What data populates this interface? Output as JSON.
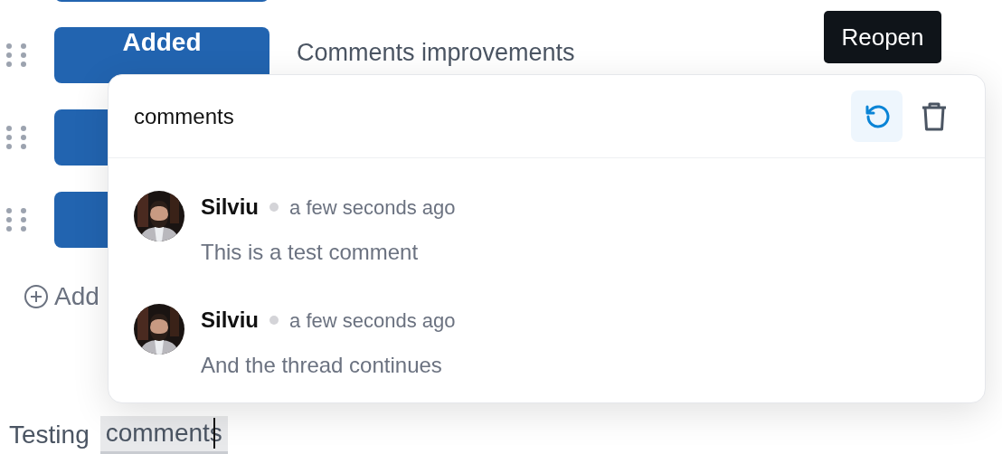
{
  "rows": [
    {
      "kind": "cut"
    },
    {
      "kind": "full",
      "badge": "Added",
      "title": "Comments improvements"
    },
    {
      "kind": "covered"
    },
    {
      "kind": "covered"
    }
  ],
  "add_link": "Add",
  "editor_text": [
    {
      "text": "Testing",
      "highlighted": false
    },
    {
      "text": "comments",
      "highlighted": true,
      "caret": true
    }
  ],
  "popover": {
    "title": "comments",
    "actions": [
      {
        "kind": "reopen",
        "selected": true
      },
      {
        "kind": "delete",
        "selected": false
      }
    ],
    "tooltip": "Reopen",
    "comments": [
      {
        "author": "Silviu",
        "time": "a few seconds ago",
        "text": "This is a test comment"
      },
      {
        "author": "Silviu",
        "time": "a few seconds ago",
        "text": "And the thread continues"
      }
    ]
  }
}
